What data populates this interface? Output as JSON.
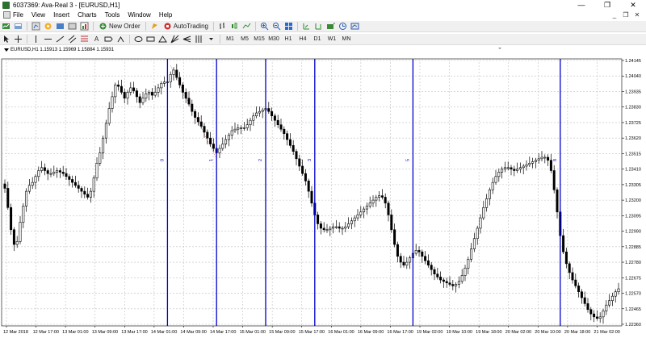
{
  "window": {
    "title": "6037369: Ava-Real 3 - [EURUSD,H1]",
    "controls": {
      "minimize": "—",
      "maximize": "❐",
      "close": "✕"
    }
  },
  "menu": {
    "items": [
      "File",
      "View",
      "Insert",
      "Charts",
      "Tools",
      "Window",
      "Help"
    ],
    "mdi": {
      "minimize": "_",
      "restore": "❐",
      "close": "✕"
    }
  },
  "toolbar": {
    "new_order": "New Order",
    "auto_trading": "AutoTrading",
    "text_tool": "A",
    "timeframes": [
      "M1",
      "M5",
      "M15",
      "M30",
      "H1",
      "H4",
      "D1",
      "W1",
      "MN"
    ]
  },
  "chart": {
    "header": "EURUSD,H1  1.15913 1.15969 1.15884 1.15931",
    "colors": {
      "candle": "#000000",
      "grid": "#c0c0c0",
      "vline": "#0000cc",
      "label": "#0000cc",
      "dotted_trend": "#cc3333"
    }
  },
  "chart_data": {
    "type": "candlestick",
    "symbol": "EURUSD",
    "timeframe": "H1",
    "y_ticks": [
      "1.24145",
      "1.24040",
      "1.23935",
      "1.23830",
      "1.23725",
      "1.23620",
      "1.23515",
      "1.23410",
      "1.23305",
      "1.23200",
      "1.23095",
      "1.22990",
      "1.22885",
      "1.22780",
      "1.22675",
      "1.22570",
      "1.22465",
      "1.22360"
    ],
    "y_range": [
      1.2236,
      1.24145
    ],
    "x_ticks": [
      "12 Mar 2018",
      "12 Mar 17:00",
      "13 Mar 01:00",
      "13 Mar 09:00",
      "13 Mar 17:00",
      "14 Mar 01:00",
      "14 Mar 09:00",
      "14 Mar 17:00",
      "15 Mar 01:00",
      "15 Mar 09:00",
      "15 Mar 17:00",
      "16 Mar 01:00",
      "16 Mar 09:00",
      "16 Mar 17:00",
      "19 Mar 02:00",
      "19 Mar 10:00",
      "19 Mar 18:00",
      "20 Mar 02:00",
      "20 Mar 10:00",
      "20 Mar 18:00",
      "21 Mar 02:00"
    ],
    "vertical_lines": [
      {
        "label": "0",
        "index": 53
      },
      {
        "label": "1",
        "index": 69
      },
      {
        "label": "2",
        "index": 85
      },
      {
        "label": "3",
        "index": 101
      },
      {
        "label": "5",
        "index": 133
      },
      {
        "label": "8",
        "index": 181
      }
    ],
    "closes": [
      1.2328,
      1.2315,
      1.23,
      1.229,
      1.2292,
      1.2305,
      1.2316,
      1.2326,
      1.233,
      1.2332,
      1.2336,
      1.234,
      1.2342,
      1.234,
      1.2338,
      1.2338,
      1.2339,
      1.234,
      1.2339,
      1.2338,
      1.2336,
      1.2334,
      1.2332,
      1.233,
      1.2328,
      1.2326,
      1.2324,
      1.2322,
      1.2326,
      1.2335,
      1.2345,
      1.2352,
      1.2362,
      1.2372,
      1.2382,
      1.239,
      1.2398,
      1.2397,
      1.2393,
      1.2389,
      1.2393,
      1.2396,
      1.2394,
      1.239,
      1.2386,
      1.2389,
      1.2392,
      1.2393,
      1.2391,
      1.2393,
      1.2396,
      1.2399,
      1.24,
      1.24,
      1.2405,
      1.2408,
      1.2403,
      1.2398,
      1.2393,
      1.2389,
      1.2385,
      1.238,
      1.2376,
      1.2373,
      1.237,
      1.2366,
      1.2362,
      1.2358,
      1.2355,
      1.2352,
      1.2355,
      1.2358,
      1.2361,
      1.2364,
      1.2367,
      1.2368,
      1.2369,
      1.2369,
      1.2369,
      1.2371,
      1.2374,
      1.2377,
      1.2379,
      1.238,
      1.2381,
      1.2382,
      1.238,
      1.2377,
      1.2374,
      1.2371,
      1.2368,
      1.2365,
      1.2361,
      1.2357,
      1.2353,
      1.2348,
      1.2343,
      1.2338,
      1.2333,
      1.2326,
      1.2318,
      1.231,
      1.2304,
      1.2301,
      1.23,
      1.23,
      1.2301,
      1.2302,
      1.2302,
      1.2301,
      1.2301,
      1.2302,
      1.2304,
      1.2306,
      1.2308,
      1.231,
      1.2312,
      1.2314,
      1.2316,
      1.2318,
      1.232,
      1.2322,
      1.2323,
      1.2322,
      1.2318,
      1.231,
      1.23,
      1.229,
      1.2282,
      1.2278,
      1.2276,
      1.2278,
      1.2281,
      1.2284,
      1.2286,
      1.2285,
      1.2282,
      1.2279,
      1.2276,
      1.2273,
      1.227,
      1.2268,
      1.2266,
      1.2265,
      1.2264,
      1.2263,
      1.2262,
      1.2263,
      1.2265,
      1.2269,
      1.2274,
      1.228,
      1.2287,
      1.2294,
      1.2301,
      1.2308,
      1.2315,
      1.2321,
      1.2327,
      1.2332,
      1.2336,
      1.2339,
      1.2341,
      1.2342,
      1.2342,
      1.2341,
      1.234,
      1.2341,
      1.2342,
      1.2343,
      1.2344,
      1.2345,
      1.2346,
      1.2347,
      1.2348,
      1.2349,
      1.2349,
      1.2347,
      1.234,
      1.2327,
      1.2312,
      1.2296,
      1.2285,
      1.2277,
      1.2271,
      1.2266,
      1.2262,
      1.2258,
      1.2254,
      1.225,
      1.2246,
      1.2243,
      1.2241,
      1.224,
      1.2241,
      1.2245,
      1.2249,
      1.2252,
      1.2255,
      1.2258,
      1.226
    ]
  }
}
